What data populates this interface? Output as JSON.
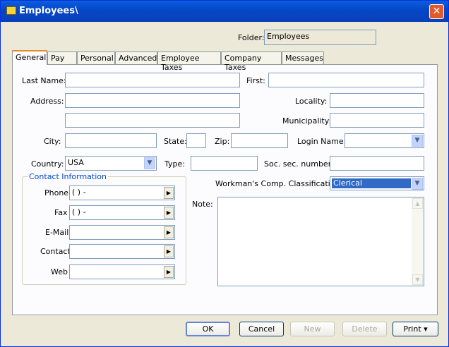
{
  "window": {
    "title": "Employees\\",
    "close_glyph": "✕"
  },
  "folder": {
    "label": "Folder:",
    "value": "Employees"
  },
  "tabs": [
    {
      "label": "General",
      "active": true
    },
    {
      "label": "Pay"
    },
    {
      "label": "Personal"
    },
    {
      "label": "Advanced"
    },
    {
      "label": "Employee Taxes"
    },
    {
      "label": "Company Taxes"
    },
    {
      "label": "Messages"
    }
  ],
  "general": {
    "last_name_label": "Last Name:",
    "last_name": "",
    "first_label": "First:",
    "first": "",
    "address_label": "Address:",
    "address1": "",
    "address2": "",
    "locality_label": "Locality:",
    "locality": "",
    "municipality_label": "Municipality:",
    "municipality": "",
    "city_label": "City:",
    "city": "",
    "state_label": "State:",
    "state": "",
    "zip_label": "Zip:",
    "zip": "",
    "login_label": "Login Name:",
    "login": "",
    "country_label": "Country:",
    "country": "USA",
    "type_label": "Type:",
    "type": "",
    "ssn_label": "Soc. sec. number:",
    "ssn": "",
    "workman_label": "Workman's Comp. Classification:",
    "workman": "Clerical",
    "note_label": "Note:"
  },
  "contact": {
    "title": "Contact Information",
    "phone_label": "Phone",
    "phone": "(   )    -",
    "fax_label": "Fax",
    "fax": "(   )    -",
    "email_label": "E-Mail",
    "email": "",
    "contact_label": "Contact",
    "contact": "",
    "web_label": "Web",
    "web": ""
  },
  "buttons": {
    "ok": "OK",
    "cancel": "Cancel",
    "new": "New",
    "delete": "Delete",
    "print": "Print ▾"
  },
  "icons": {
    "dropdown": "▼",
    "arrow_right": "▶",
    "scroll_up": "▲",
    "scroll_down": "▼"
  }
}
